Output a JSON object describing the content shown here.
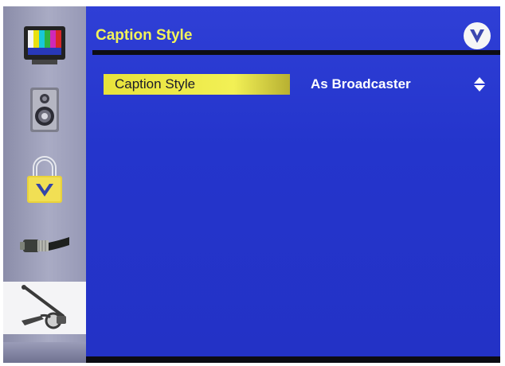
{
  "menu": {
    "title": "Caption Style",
    "logo": "vizio-v-logo-icon"
  },
  "setting": {
    "label": "Caption Style",
    "value": "As Broadcaster",
    "adjust_icon": "up-down-arrows-icon"
  },
  "sidebar": {
    "items": [
      {
        "icon": "tv-color-bars-icon",
        "selected": false
      },
      {
        "icon": "speaker-icon",
        "selected": false
      },
      {
        "icon": "padlock-icon",
        "selected": false
      },
      {
        "icon": "coax-cable-icon",
        "selected": false
      },
      {
        "icon": "wrench-tools-icon",
        "selected": true
      }
    ]
  },
  "colors": {
    "panel_blue": "#2b3bd2",
    "title_yellow": "#f2f25a",
    "highlight_yellow": "#f2f055",
    "sidebar_gray": "#a9abc4"
  }
}
